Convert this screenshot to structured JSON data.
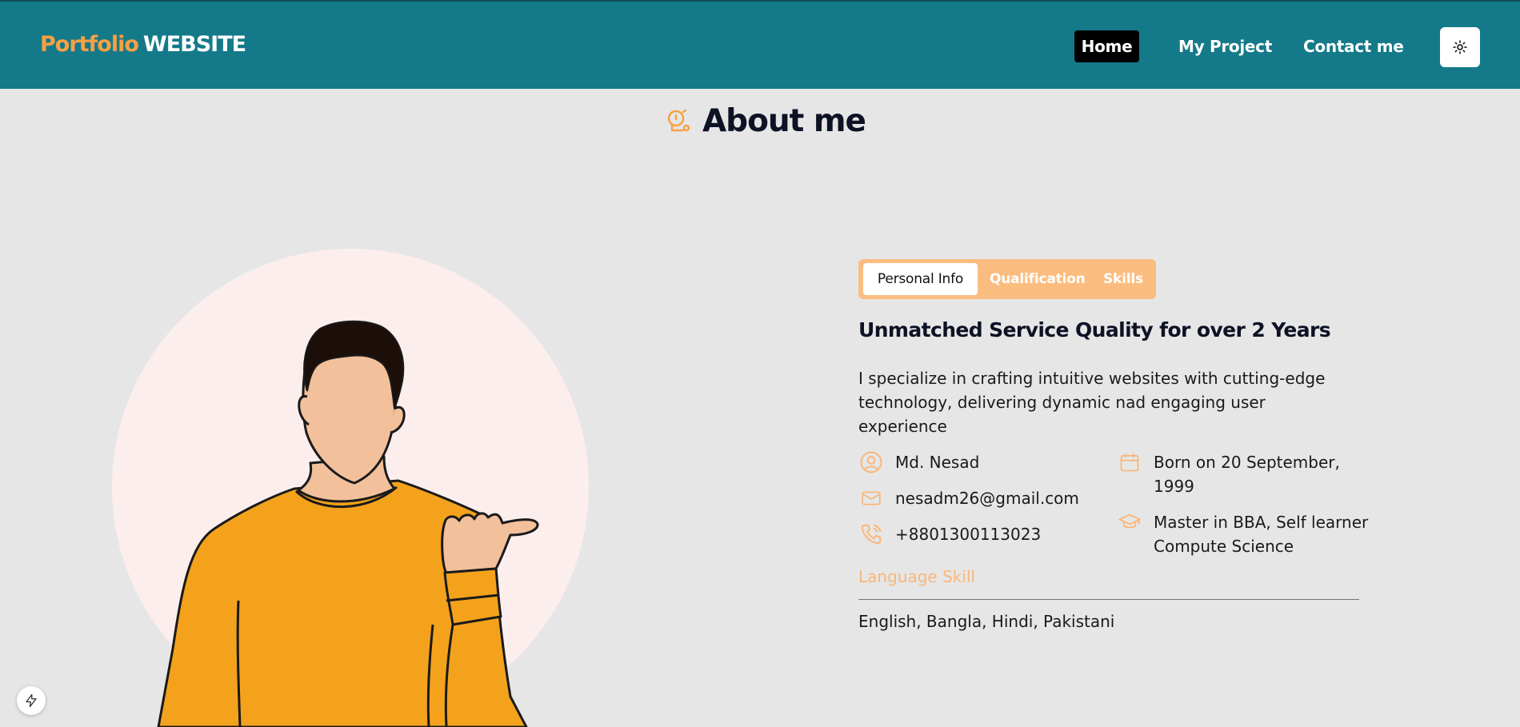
{
  "header": {
    "logo_part1": "Portfolio",
    "logo_part2": "WEBSITE",
    "nav": {
      "home": "Home",
      "project": "My Project",
      "contact": "Contact me"
    },
    "theme_toggle_icon": "sun-icon"
  },
  "about": {
    "title": "About me",
    "title_icon": "alarm-bell-icon"
  },
  "tabs": {
    "personal": "Personal Info",
    "qualification": "Qualification",
    "skills": "Skills",
    "active": "Personal Info"
  },
  "personal": {
    "headline": "Unmatched Service Quality for over 2 Years",
    "description": "I specialize in crafting intuitive websites with cutting-edge technology, delivering dynamic nad engaging user experience",
    "name": "Md. Nesad",
    "email": "nesadm26@gmail.com",
    "phone": "+8801300113023",
    "born": "Born on 20 September, 1999",
    "education": "Master in BBA, Self learner Compute Science",
    "language_label": "Language Skill",
    "languages": "English, Bangla, Hindi, Pakistani"
  },
  "colors": {
    "header_bg": "#147a8a",
    "accent": "#f7a043",
    "tab_bg": "#fbbd7f",
    "page_bg": "#e6e6e6",
    "avatar_circle": "#fdeeee",
    "shirt": "#f4a21c"
  },
  "floating_button_icon": "lightning-icon"
}
